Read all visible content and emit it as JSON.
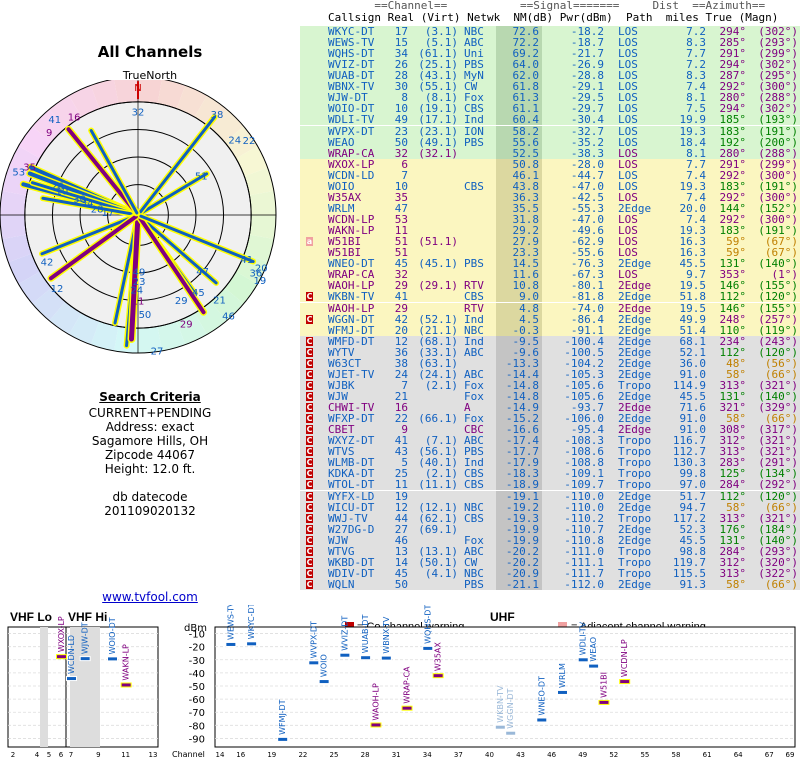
{
  "left": {
    "title": "All Channels",
    "truenorth": "TrueNorth",
    "north_marker": "N",
    "polar_labels": [
      {
        "n": "32",
        "b": 0,
        "r": 0.75,
        "c": "#1060c0"
      },
      {
        "n": "38",
        "b": 38,
        "r": 0.93,
        "c": "#1060c0"
      },
      {
        "n": "22",
        "b": 56,
        "r": 0.97,
        "c": "#1060c0"
      },
      {
        "n": "24",
        "b": 52,
        "r": 0.89,
        "c": "#1060c0"
      },
      {
        "n": "51",
        "b": 58,
        "r": 0.54,
        "c": "#1060c0"
      },
      {
        "n": "41",
        "b": -41,
        "r": 0.92,
        "c": "#1060c0"
      },
      {
        "n": "16",
        "b": -33,
        "r": 0.85,
        "c": "#800080"
      },
      {
        "n": "9",
        "b": -47,
        "r": 0.88,
        "c": "#800080"
      },
      {
        "n": "53",
        "b": -70,
        "r": 0.92,
        "c": "#1060c0"
      },
      {
        "n": "35",
        "b": -66,
        "r": 0.86,
        "c": "#800080"
      },
      {
        "n": "26",
        "b": -70,
        "r": 0.62,
        "c": "#1060c0"
      },
      {
        "n": "10",
        "b": -72,
        "r": 0.58,
        "c": "#1060c0"
      },
      {
        "n": "30",
        "b": -74,
        "r": 0.44,
        "c": "#1060c0"
      },
      {
        "n": "34",
        "b": -76,
        "r": 0.38,
        "c": "#1060c0"
      },
      {
        "n": "17",
        "b": -84,
        "r": 0.22,
        "c": "#1060c0"
      },
      {
        "n": "28",
        "b": -81,
        "r": 0.3,
        "c": "#1060c0"
      },
      {
        "n": "42",
        "b": -117,
        "r": 0.74,
        "c": "#1060c0"
      },
      {
        "n": "12",
        "b": -132,
        "r": 0.79,
        "c": "#1060c0"
      },
      {
        "n": "47",
        "b": 131,
        "r": 0.62,
        "c": "#1060c0"
      },
      {
        "n": "45",
        "b": 142,
        "r": 0.71,
        "c": "#1060c0"
      },
      {
        "n": "36",
        "b": 116,
        "r": 0.95,
        "c": "#1060c0"
      },
      {
        "n": "41",
        "b": 112,
        "r": 0.85,
        "c": "#1060c0"
      },
      {
        "n": "20",
        "b": 113,
        "r": 0.97,
        "c": "#1060c0"
      },
      {
        "n": "19",
        "b": 118,
        "r": 1.0,
        "c": "#1060c0"
      },
      {
        "n": "29",
        "b": 153,
        "r": 0.69,
        "c": "#1060c0"
      },
      {
        "n": "21",
        "b": 136,
        "r": 0.85,
        "c": "#1060c0"
      },
      {
        "n": "46",
        "b": 138,
        "r": 0.98,
        "c": "#1060c0"
      },
      {
        "n": "29",
        "b": 156,
        "r": 0.86,
        "c": "#800080"
      },
      {
        "n": "49",
        "b": 179,
        "r": 0.41,
        "c": "#1060c0"
      },
      {
        "n": "23",
        "b": 179,
        "r": 0.48,
        "c": "#1060c0"
      },
      {
        "n": "24",
        "b": 181,
        "r": 0.54,
        "c": "#1060c0"
      },
      {
        "n": "11",
        "b": 180,
        "r": 0.62,
        "c": "#800080"
      },
      {
        "n": "50",
        "b": 176,
        "r": 0.72,
        "c": "#1060c0"
      },
      {
        "n": "27",
        "b": 172,
        "r": 0.99,
        "c": "#1060c0"
      }
    ]
  },
  "criteria": {
    "heading": "Search Criteria",
    "mode": "CURRENT+PENDING",
    "address": "Address: exact",
    "city": "Sagamore Hills, OH",
    "zip": "Zipcode 44067",
    "height": "Height: 12.0 ft.",
    "dbdate_label": "db datecode",
    "dbdate": "201109020132",
    "site": "www.tvfool.com"
  },
  "table": {
    "header1": "       ==Channel==           ==Signal=======     Dist  ==Azimuth==",
    "header2": "Callsign Real (Virt) Netwk  NM(dB) Pwr(dBm)  Path  miles True (Magn)",
    "rows": [
      [
        "WKYC-DT",
        "17",
        "(3.1)",
        "NBC",
        "72.6",
        "-18.2",
        "LOS",
        "7.2",
        "294°",
        "(302°)",
        "g",
        ""
      ],
      [
        "WEWS-TV",
        "15",
        "(5.1)",
        "ABC",
        "72.2",
        "-18.7",
        "LOS",
        "8.3",
        "285°",
        "(293°)",
        "g",
        ""
      ],
      [
        "WQHS-DT",
        "34",
        "(61.1)",
        "Uni",
        "69.2",
        "-21.7",
        "LOS",
        "7.7",
        "291°",
        "(299°)",
        "g",
        ""
      ],
      [
        "WVIZ-DT",
        "26",
        "(25.1)",
        "PBS",
        "64.0",
        "-26.9",
        "LOS",
        "7.2",
        "294°",
        "(302°)",
        "g",
        ""
      ],
      [
        "WUAB-DT",
        "28",
        "(43.1)",
        "MyN",
        "62.0",
        "-28.8",
        "LOS",
        "8.3",
        "287°",
        "(295°)",
        "g",
        ""
      ],
      [
        "WBNX-TV",
        "30",
        "(55.1)",
        "CW",
        "61.8",
        "-29.1",
        "LOS",
        "7.4",
        "292°",
        "(300°)",
        "g",
        ""
      ],
      [
        "WJW-DT",
        "8",
        "(8.1)",
        "Fox",
        "61.3",
        "-29.5",
        "LOS",
        "8.1",
        "280°",
        "(288°)",
        "g",
        ""
      ],
      [
        "WOIO-DT",
        "10",
        "(19.1)",
        "CBS",
        "61.1",
        "-29.7",
        "LOS",
        "7.5",
        "294°",
        "(302°)",
        "g",
        ""
      ],
      [
        "WDLI-TV",
        "49",
        "(17.1)",
        "Ind",
        "60.4",
        "-30.4",
        "LOS",
        "19.9",
        "185°",
        "(193°)",
        "g",
        ""
      ],
      [
        "WVPX-DT",
        "23",
        "(23.1)",
        "ION",
        "58.2",
        "-32.7",
        "LOS",
        "19.3",
        "183°",
        "(191°)",
        "g",
        ""
      ],
      [
        "WEAO",
        "50",
        "(49.1)",
        "PBS",
        "55.6",
        "-35.2",
        "LOS",
        "18.4",
        "192°",
        "(200°)",
        "g",
        ""
      ],
      [
        "WRAP-CA",
        "32",
        "(32.1)",
        "",
        "52.5",
        "-38.3",
        "LOS",
        "8.1",
        "280°",
        "(288°)",
        "g",
        ""
      ],
      [
        "WXOX-LP",
        "6",
        "",
        "",
        "50.8",
        "-28.0",
        "LOS",
        "7.7",
        "291°",
        "(299°)",
        "y",
        ""
      ],
      [
        "WCDN-LD",
        "7",
        "",
        "",
        "46.1",
        "-44.7",
        "LOS",
        "7.4",
        "292°",
        "(300°)",
        "y",
        ""
      ],
      [
        "WOIO",
        "10",
        "",
        "CBS",
        "43.8",
        "-47.0",
        "LOS",
        "19.3",
        "183°",
        "(191°)",
        "y",
        ""
      ],
      [
        "W35AX",
        "35",
        "",
        "",
        "36.3",
        "-42.5",
        "LOS",
        "7.4",
        "292°",
        "(300°)",
        "y",
        ""
      ],
      [
        "WRLM",
        "47",
        "",
        "",
        "35.5",
        "-55.3",
        "2Edge",
        "20.0",
        "144°",
        "(152°)",
        "y",
        ""
      ],
      [
        "WCDN-LP",
        "53",
        "",
        "",
        "31.8",
        "-47.0",
        "LOS",
        "7.4",
        "292°",
        "(300°)",
        "y",
        ""
      ],
      [
        "WAKN-LP",
        "11",
        "",
        "",
        "29.2",
        "-49.6",
        "LOS",
        "19.3",
        "183°",
        "(191°)",
        "y",
        ""
      ],
      [
        "W51BI",
        "51",
        "(51.1)",
        "",
        "27.9",
        "-62.9",
        "LOS",
        "16.3",
        "59°",
        "(67°)",
        "y",
        "a"
      ],
      [
        "W51BI",
        "51",
        "",
        "",
        "23.3",
        "-55.6",
        "LOS",
        "16.3",
        "59°",
        "(67°)",
        "y",
        ""
      ],
      [
        "WNEO-DT",
        "45",
        "(45.1)",
        "PBS",
        "14.5",
        "-76.3",
        "2Edge",
        "45.5",
        "131°",
        "(140°)",
        "y",
        ""
      ],
      [
        "WRAP-CA",
        "32",
        "",
        "",
        "11.6",
        "-67.3",
        "LOS",
        "9.7",
        "353°",
        "(1°)",
        "y",
        ""
      ],
      [
        "WAOH-LP",
        "29",
        "(29.1)",
        "RTV",
        "10.8",
        "-80.1",
        "2Edge",
        "19.5",
        "146°",
        "(155°)",
        "y",
        ""
      ],
      [
        "WKBN-TV",
        "41",
        "",
        "CBS",
        "9.0",
        "-81.8",
        "2Edge",
        "51.8",
        "112°",
        "(120°)",
        "y",
        "C"
      ],
      [
        "WAOH-LP",
        "29",
        "",
        "RTV",
        "4.8",
        "-74.0",
        "2Edge",
        "19.5",
        "146°",
        "(155°)",
        "y",
        ""
      ],
      [
        "WGGN-DT",
        "42",
        "(52.1)",
        "Ind",
        "4.5",
        "-86.4",
        "2Edge",
        "49.9",
        "248°",
        "(257°)",
        "y",
        "C"
      ],
      [
        "WFMJ-DT",
        "20",
        "(21.1)",
        "NBC",
        "-0.3",
        "-91.1",
        "2Edge",
        "51.4",
        "110°",
        "(119°)",
        "y",
        ""
      ],
      [
        "WMFD-DT",
        "12",
        "(68.1)",
        "Ind",
        "-9.5",
        "-100.4",
        "2Edge",
        "68.1",
        "234°",
        "(243°)",
        "s",
        "C"
      ],
      [
        "WYTV",
        "36",
        "(33.1)",
        "ABC",
        "-9.6",
        "-100.5",
        "2Edge",
        "52.1",
        "112°",
        "(120°)",
        "s",
        "C"
      ],
      [
        "W63CT",
        "38",
        "(63.1)",
        "",
        "-13.3",
        "-104.2",
        "2Edge",
        "36.0",
        "48°",
        "(56°)",
        "s",
        "C"
      ],
      [
        "WJET-TV",
        "24",
        "(24.1)",
        "ABC",
        "-14.4",
        "-105.3",
        "2Edge",
        "91.0",
        "58°",
        "(66°)",
        "s",
        "C"
      ],
      [
        "WJBK",
        "7",
        "(2.1)",
        "Fox",
        "-14.8",
        "-105.6",
        "Tropo",
        "114.9",
        "313°",
        "(321°)",
        "s",
        "C"
      ],
      [
        "WJW",
        "21",
        "",
        "Fox",
        "-14.8",
        "-105.6",
        "2Edge",
        "45.5",
        "131°",
        "(140°)",
        "s",
        "C"
      ],
      [
        "CHWI-TV",
        "16",
        "",
        "A",
        "-14.9",
        "-93.7",
        "2Edge",
        "71.6",
        "321°",
        "(329°)",
        "s",
        "C"
      ],
      [
        "WFXP-DT",
        "22",
        "(66.1)",
        "Fox",
        "-15.2",
        "-106.0",
        "2Edge",
        "91.0",
        "58°",
        "(66°)",
        "s",
        "C"
      ],
      [
        "CBET",
        "9",
        "",
        "CBC",
        "-16.6",
        "-95.4",
        "2Edge",
        "91.0",
        "308°",
        "(317°)",
        "s",
        "C"
      ],
      [
        "WXYZ-DT",
        "41",
        "(7.1)",
        "ABC",
        "-17.4",
        "-108.3",
        "Tropo",
        "116.7",
        "312°",
        "(321°)",
        "s",
        "C"
      ],
      [
        "WTVS",
        "43",
        "(56.1)",
        "PBS",
        "-17.7",
        "-108.6",
        "Tropo",
        "112.7",
        "313°",
        "(321°)",
        "s",
        "C"
      ],
      [
        "WLMB-DT",
        "5",
        "(40.1)",
        "Ind",
        "-17.9",
        "-108.8",
        "Tropo",
        "130.3",
        "283°",
        "(291°)",
        "s",
        "C"
      ],
      [
        "KDKA-DT",
        "25",
        "(2.1)",
        "CBS",
        "-18.3",
        "-109.1",
        "Tropo",
        "99.8",
        "125°",
        "(134°)",
        "s",
        "C"
      ],
      [
        "WTOL-DT",
        "11",
        "(11.1)",
        "CBS",
        "-18.9",
        "-109.7",
        "Tropo",
        "97.0",
        "284°",
        "(292°)",
        "s",
        "C"
      ],
      [
        "WYFX-LD",
        "19",
        "",
        "",
        "-19.1",
        "-110.0",
        "2Edge",
        "51.7",
        "112°",
        "(120°)",
        "s",
        "C"
      ],
      [
        "WICU-DT",
        "12",
        "(12.1)",
        "NBC",
        "-19.2",
        "-110.0",
        "2Edge",
        "94.7",
        "58°",
        "(66°)",
        "s",
        "C"
      ],
      [
        "WWJ-TV",
        "44",
        "(62.1)",
        "CBS",
        "-19.3",
        "-110.2",
        "Tropo",
        "117.2",
        "313°",
        "(321°)",
        "s",
        "C"
      ],
      [
        "W27DG-D",
        "27",
        "(69.1)",
        "",
        "-19.9",
        "-110.7",
        "2Edge",
        "52.3",
        "176°",
        "(184°)",
        "s",
        "C"
      ],
      [
        "WJW",
        "46",
        "",
        "Fox",
        "-19.9",
        "-110.8",
        "2Edge",
        "45.5",
        "131°",
        "(140°)",
        "s",
        "C"
      ],
      [
        "WTVG",
        "13",
        "(13.1)",
        "ABC",
        "-20.2",
        "-111.0",
        "Tropo",
        "98.8",
        "284°",
        "(293°)",
        "s",
        "C"
      ],
      [
        "WKBD-DT",
        "14",
        "(50.1)",
        "CW",
        "-20.2",
        "-111.1",
        "Tropo",
        "119.7",
        "312°",
        "(320°)",
        "s",
        "C"
      ],
      [
        "WDIV-DT",
        "45",
        "(4.1)",
        "NBC",
        "-20.9",
        "-111.7",
        "Tropo",
        "115.5",
        "313°",
        "(322°)",
        "s",
        "C"
      ],
      [
        "WQLN",
        "50",
        "",
        "PBS",
        "-21.1",
        "-112.0",
        "2Edge",
        "91.3",
        "58°",
        "(66°)",
        "s",
        "C"
      ]
    ]
  },
  "chart_data": {
    "type": "bar",
    "title": "",
    "legend": {
      "co": "= Co-channel warning",
      "adj": "= Adjacent channel warning"
    },
    "yunit": "dBm",
    "ylim": [
      -95,
      -5
    ],
    "yticks": [
      "-10",
      "-20",
      "-30",
      "-40",
      "-50",
      "-60",
      "-70",
      "-80",
      "-90"
    ],
    "vhf_lo_label": "VHF Lo",
    "vhf_hi_label": "VHF Hi",
    "uhf_label": "UHF",
    "channel_axis_label": "Channel",
    "vhf_lo_ticks": [
      "2",
      "4",
      "5",
      "6"
    ],
    "vhf_hi_ticks": [
      "7",
      "9",
      "11",
      "13"
    ],
    "uhf_ticks": [
      "14",
      "16",
      "19",
      "22",
      "25",
      "28",
      "31",
      "34",
      "37",
      "40",
      "43",
      "46",
      "49",
      "52",
      "55",
      "58",
      "61",
      "64",
      "67",
      "69"
    ],
    "bars": [
      {
        "name": "WXOX-LP",
        "ch": 6,
        "dbm": -28,
        "c": "#800080",
        "band": "lo"
      },
      {
        "name": "WCDN-LD",
        "ch": 7,
        "dbm": -44.7,
        "c": "#1060c0",
        "band": "hi"
      },
      {
        "name": "WJW-DT",
        "ch": 8,
        "dbm": -29.5,
        "c": "#1060c0",
        "band": "hi"
      },
      {
        "name": "WOIO-DT",
        "ch": 10,
        "dbm": -29.7,
        "c": "#1060c0",
        "band": "hi"
      },
      {
        "name": "WAKN-LP",
        "ch": 11,
        "dbm": -49.6,
        "c": "#800080",
        "band": "hi"
      },
      {
        "name": "WEWS-TV",
        "ch": 15,
        "dbm": -18.7,
        "c": "#1060c0",
        "band": "u"
      },
      {
        "name": "WKYC-DT",
        "ch": 17,
        "dbm": -18.2,
        "c": "#1060c0",
        "band": "u"
      },
      {
        "name": "WFMJ-DT",
        "ch": 20,
        "dbm": -91.1,
        "c": "#1060c0",
        "band": "u"
      },
      {
        "name": "WVPX-DT",
        "ch": 23,
        "dbm": -32.7,
        "c": "#1060c0",
        "band": "u"
      },
      {
        "name": "WOIO",
        "ch": 24,
        "dbm": -47,
        "c": "#1060c0",
        "band": "u"
      },
      {
        "name": "WVIZ-DT",
        "ch": 26,
        "dbm": -26.9,
        "c": "#1060c0",
        "band": "u"
      },
      {
        "name": "WUAB-DT",
        "ch": 28,
        "dbm": -28.8,
        "c": "#1060c0",
        "band": "u"
      },
      {
        "name": "WAOH-LP",
        "ch": 29,
        "dbm": -80.1,
        "c": "#800080",
        "band": "u"
      },
      {
        "name": "WBNX-TV",
        "ch": 30,
        "dbm": -29.1,
        "c": "#1060c0",
        "band": "u"
      },
      {
        "name": "WRAP-CA",
        "ch": 32,
        "dbm": -67.3,
        "c": "#800080",
        "band": "u"
      },
      {
        "name": "WQHS-DT",
        "ch": 34,
        "dbm": -21.7,
        "c": "#1060c0",
        "band": "u"
      },
      {
        "name": "W35AX",
        "ch": 35,
        "dbm": -42.5,
        "c": "#800080",
        "band": "u"
      },
      {
        "name": "WKBN-TV",
        "ch": 41,
        "dbm": -81.8,
        "c": "#9ab8d8",
        "band": "u"
      },
      {
        "name": "WGGN-DT",
        "ch": 42,
        "dbm": -86.4,
        "c": "#9ab8d8",
        "band": "u"
      },
      {
        "name": "WNEO-DT",
        "ch": 45,
        "dbm": -76.3,
        "c": "#1060c0",
        "band": "u"
      },
      {
        "name": "WRLM",
        "ch": 47,
        "dbm": -55.3,
        "c": "#1060c0",
        "band": "u"
      },
      {
        "name": "WDLI-TV",
        "ch": 49,
        "dbm": -30.4,
        "c": "#1060c0",
        "band": "u"
      },
      {
        "name": "WEAO",
        "ch": 50,
        "dbm": -35.2,
        "c": "#1060c0",
        "band": "u"
      },
      {
        "name": "W51BI",
        "ch": 51,
        "dbm": -62.9,
        "c": "#800080",
        "band": "u"
      },
      {
        "name": "WCDN-LP",
        "ch": 53,
        "dbm": -47,
        "c": "#800080",
        "band": "u"
      }
    ]
  }
}
